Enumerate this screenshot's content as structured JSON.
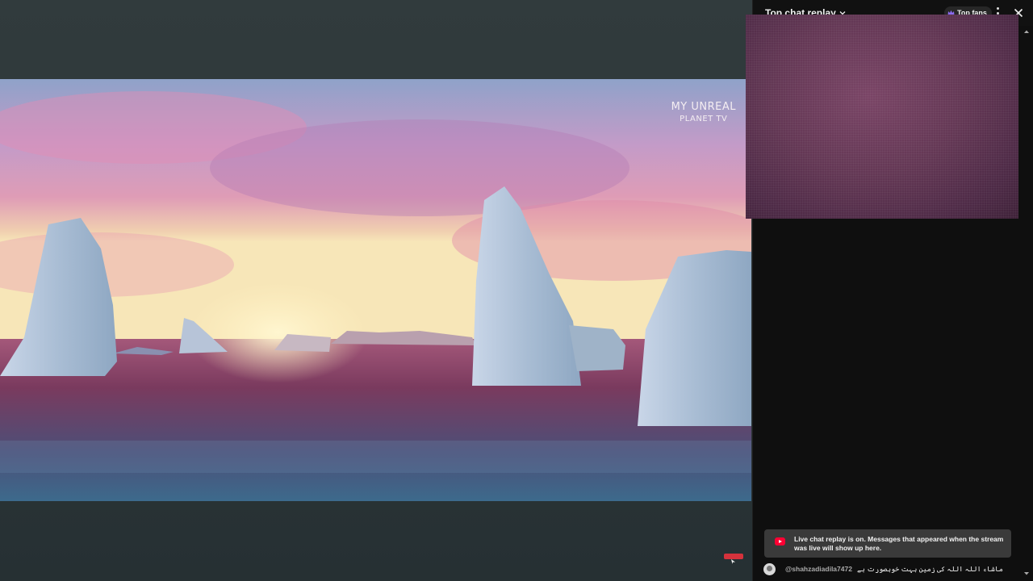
{
  "video": {
    "watermark_line1": "MY UNREAL",
    "watermark_line2": "PLANET TV"
  },
  "chat": {
    "title": "Top chat replay",
    "top_fans_label": "Top fans",
    "replay_notice": "Live chat replay is on. Messages that appeared when the stream was live will show up here.",
    "messages": [
      {
        "author": "@shahzadiadila7472",
        "text": "ماشاء اللہ اللہ کی زمین بہت خوبصورت ہے"
      }
    ]
  },
  "colors": {
    "chat_background": "#0f0f0f",
    "accent_red": "#ff0033",
    "fans_badge_icon": "#8b6bf0"
  }
}
